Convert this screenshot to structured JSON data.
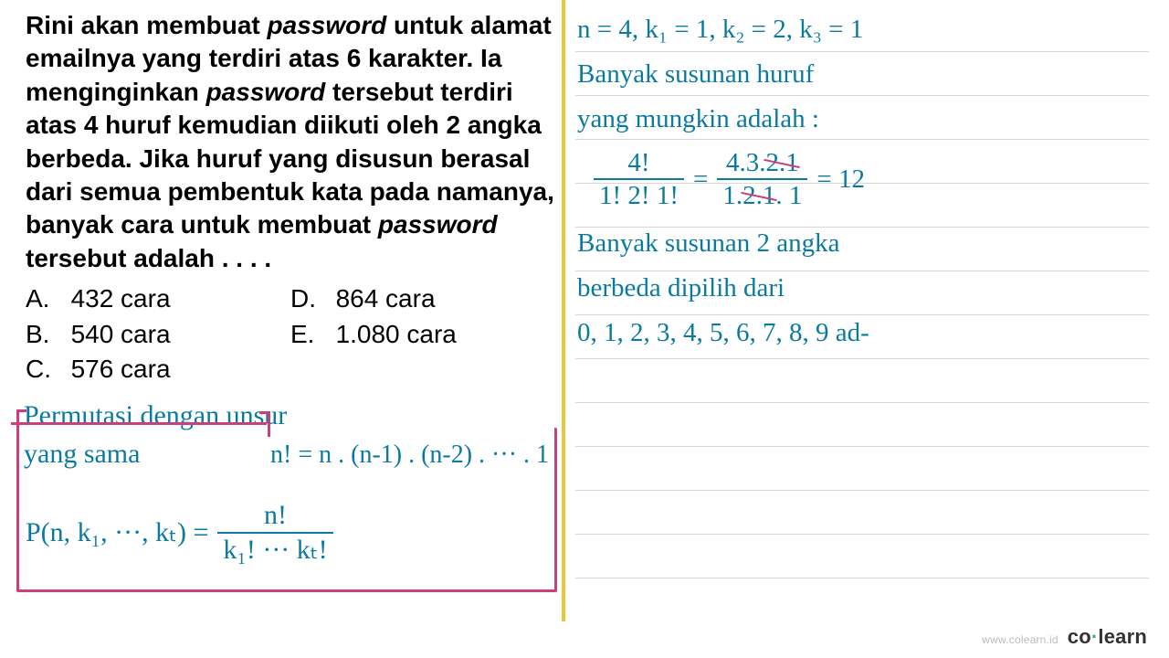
{
  "question": {
    "stem_html": "Rini akan membuat <em>password</em> untuk alamat emailnya yang terdiri atas 6 karakter. Ia menginginkan <em>password</em> tersebut terdiri atas 4 huruf kemudian diikuti oleh 2 angka berbeda. Jika huruf yang disusun berasal dari semua pembentuk kata pada namanya, banyak cara untuk membuat <em>password</em> tersebut adalah . . . .",
    "choices": {
      "A": "432 cara",
      "B": "540 cara",
      "C": "576 cara",
      "D": "864 cara",
      "E": "1.080 cara"
    }
  },
  "perm_box": {
    "title_line1": "Permutasi dengan unsur",
    "title_line2": "yang sama",
    "factorial_def": "n! = n . (n-1) . (n-2) . ··· . 1",
    "formula_lhs": "P(n, k₁, ···, kₜ) =",
    "formula_num": "n!",
    "formula_den": "k₁! ··· kₜ!"
  },
  "work": {
    "line1": "n = 4, k₁ = 1, k₂ = 2, k₃ = 1",
    "line2": "Banyak susunan huruf",
    "line3": "yang mungkin adalah :",
    "frac1_num": "4!",
    "frac1_den": "1! 2! 1!",
    "frac2_num_a": "4.3.",
    "frac2_num_b": "2.1",
    "frac2_den_a": "1.",
    "frac2_den_b": "2.1",
    "frac2_den_c": ". 1",
    "result": "= 12",
    "line5": "Banyak susunan 2 angka",
    "line6": "berbeda dipilih dari",
    "line7": "0, 1, 2, 3, 4, 5, 6, 7, 8, 9  ad-"
  },
  "footer": {
    "url": "www.colearn.id",
    "brand_pre": "co",
    "brand_post": "learn"
  }
}
